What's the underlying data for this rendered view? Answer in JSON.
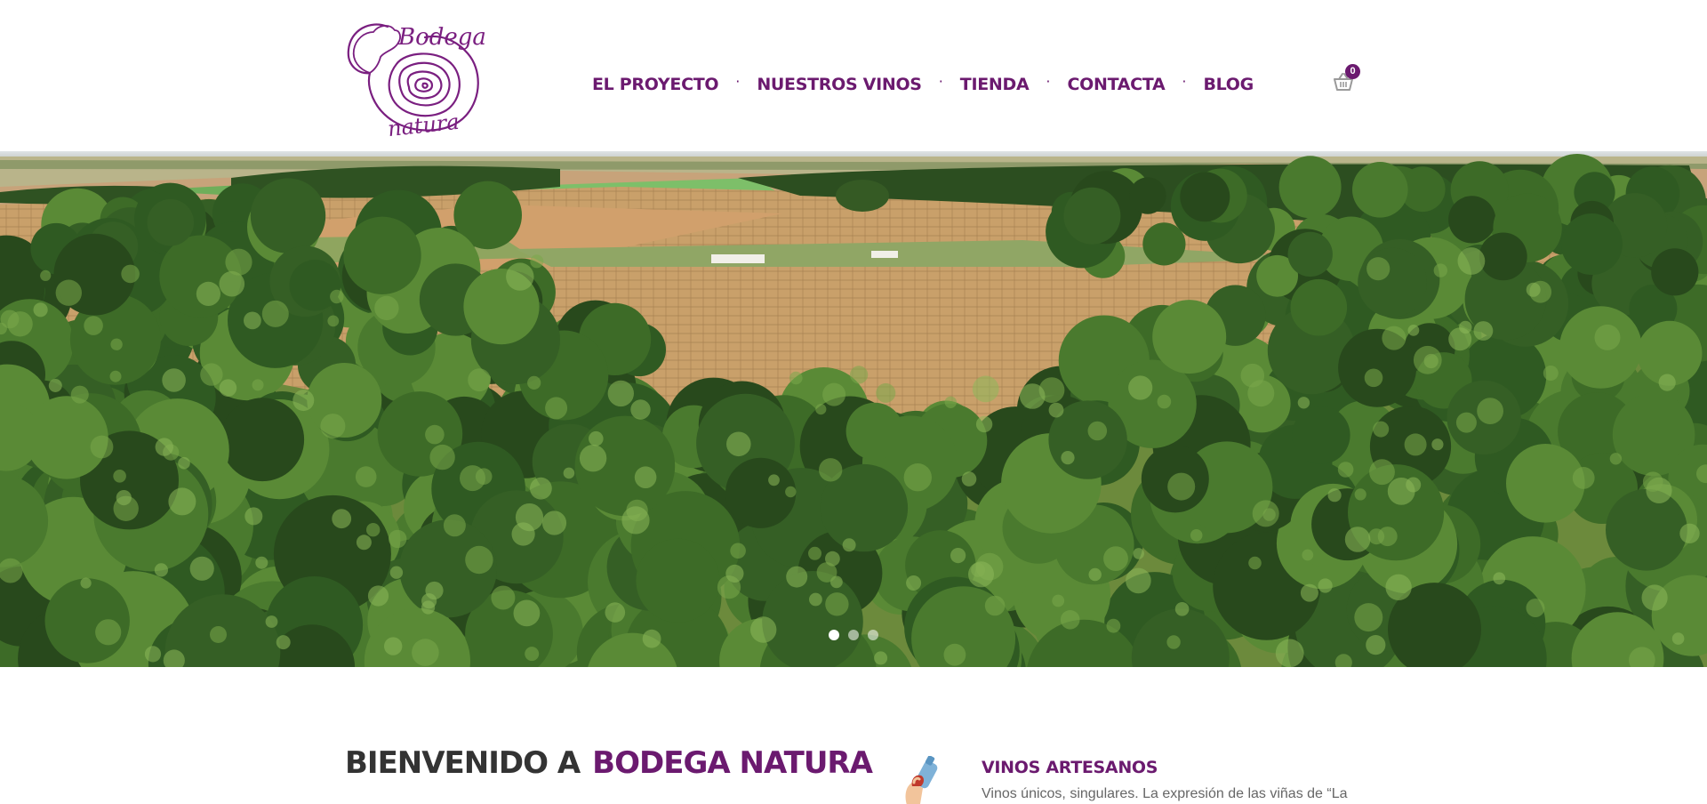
{
  "brand": {
    "logo_line1": "Bodega",
    "logo_line2": "natura",
    "accent_color": "#6b1a6f"
  },
  "nav": {
    "items": [
      {
        "label": "EL PROYECTO"
      },
      {
        "label": "NUESTROS VINOS"
      },
      {
        "label": "TIENDA"
      },
      {
        "label": "CONTACTA"
      },
      {
        "label": "BLOG"
      }
    ],
    "separator": "·"
  },
  "cart": {
    "icon": "basket-icon",
    "count": "0"
  },
  "hero": {
    "image": "aerial-vineyard-pine-forest",
    "slides": 3,
    "active_slide": 1
  },
  "welcome": {
    "prefix": "BIENVENIDO A",
    "brand": "BODEGA NATURA"
  },
  "feature": {
    "icon": "wine-bottle-hand-icon",
    "title": "VINOS ARTESANOS",
    "text": "Vinos únicos, singulares. La expresión de las viñas de “La"
  }
}
